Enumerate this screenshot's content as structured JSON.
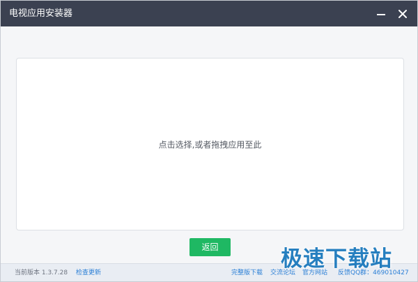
{
  "window": {
    "title": "电视应用安装器",
    "minimize_icon": "minimize-icon",
    "close_icon": "close-icon"
  },
  "dropzone": {
    "hint": "点击选择,或者拖拽应用至此"
  },
  "actions": {
    "back_label": "返回"
  },
  "statusbar": {
    "version_label": "当前版本 1.3.7.28",
    "check_update": "检查更新",
    "full_download": "完整版下载",
    "forum": "交流论坛",
    "official_site": "官方网站",
    "feedback_qq": "反馈QQ群：469010427"
  },
  "watermark": "极速下载站",
  "colors": {
    "titlebar": "#3b4151",
    "accent_green": "#1fb863",
    "link_blue": "#2b7fd6"
  }
}
